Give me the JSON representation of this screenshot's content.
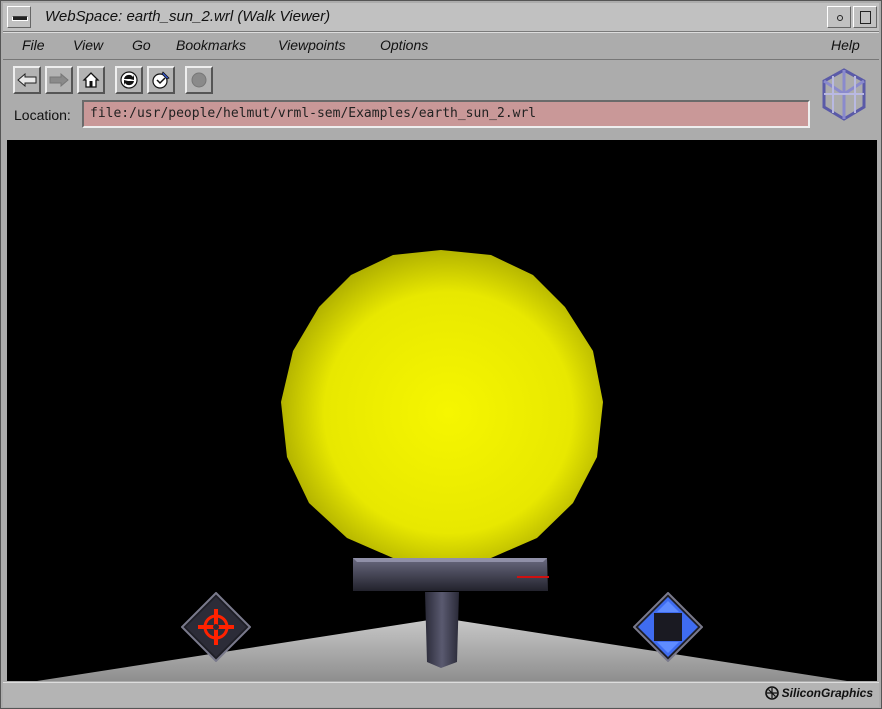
{
  "window": {
    "title": "WebSpace: earth_sun_2.wrl (Walk Viewer)"
  },
  "menu": {
    "items": [
      "File",
      "View",
      "Go",
      "Bookmarks",
      "Viewpoints",
      "Options"
    ],
    "help": "Help"
  },
  "location": {
    "label": "Location:",
    "value": "file:/usr/people/helmut/vrml-sem/Examples/earth_sun_2.wrl"
  },
  "status": {
    "brand": "SiliconGraphics"
  },
  "colors": {
    "sun": "#ffff00",
    "background": "#000000",
    "location_field": "#c99898",
    "nav_left_accent": "#ff2200",
    "nav_right_accent": "#3f6cf0"
  },
  "icons": {
    "back": "arrow-left-icon",
    "forward": "arrow-right-icon",
    "home": "home-icon",
    "reload": "reload-icon",
    "edit": "edit-icon",
    "stop": "stop-icon"
  }
}
